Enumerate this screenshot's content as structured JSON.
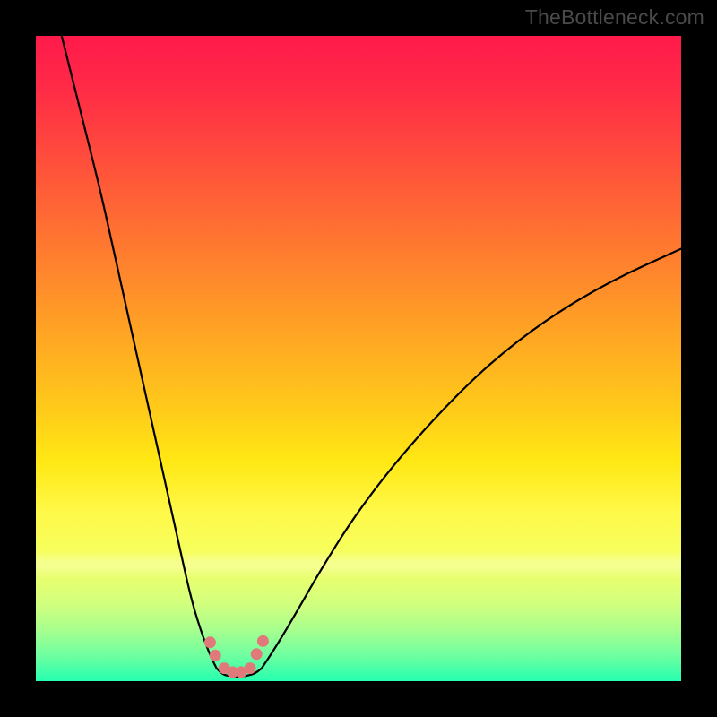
{
  "attribution": "TheBottleneck.com",
  "colors": {
    "frame": "#000000",
    "curve": "#000000",
    "marker": "#e07a7a",
    "gradient_top": "#ff1a4b",
    "gradient_bottom": "#26ffb0"
  },
  "chart_data": {
    "type": "line",
    "title": "",
    "xlabel": "",
    "ylabel": "",
    "xlim": [
      0,
      100
    ],
    "ylim": [
      0,
      100
    ],
    "grid": false,
    "legend": false,
    "note": "x and y are percentages of the plot area; (0,0) is bottom-left. Values are read off pixel positions; no axis ticks are shown in the source image.",
    "series": [
      {
        "name": "left-branch",
        "x": [
          4,
          6,
          8,
          10,
          12,
          14,
          16,
          18,
          20,
          22,
          24,
          25.5,
          27,
          28
        ],
        "y": [
          100,
          92,
          84,
          76,
          67,
          58,
          49,
          40,
          31,
          22,
          13,
          8,
          4,
          2
        ]
      },
      {
        "name": "trough",
        "x": [
          28,
          29,
          30,
          31,
          32,
          33,
          34,
          35
        ],
        "y": [
          2,
          1,
          0.8,
          0.7,
          0.7,
          0.9,
          1.2,
          2
        ]
      },
      {
        "name": "right-branch",
        "x": [
          35,
          37,
          40,
          44,
          49,
          55,
          62,
          70,
          79,
          89,
          100
        ],
        "y": [
          2,
          5,
          10,
          17,
          25,
          33,
          41,
          49,
          56,
          62,
          67
        ]
      }
    ],
    "markers": {
      "name": "trough-markers",
      "shape": "circle",
      "color": "#e07a7a",
      "x": [
        27.0,
        27.8,
        29.2,
        30.5,
        31.8,
        33.2,
        34.2,
        35.2
      ],
      "y": [
        6.0,
        4.0,
        2.0,
        1.4,
        1.4,
        2.0,
        4.2,
        6.2
      ]
    }
  }
}
